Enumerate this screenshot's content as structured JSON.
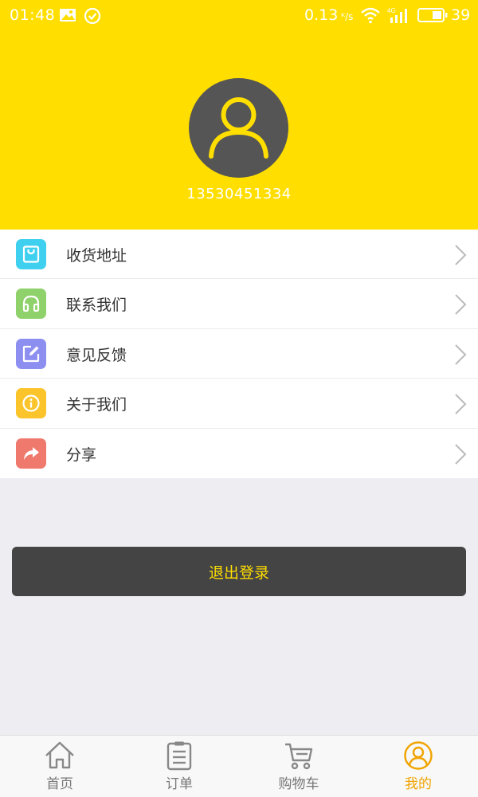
{
  "status_bar": {
    "time": "01:48",
    "speed": "0.13",
    "battery": "39",
    "icons": [
      "image-icon",
      "check-circle-icon",
      "wifi-icon",
      "signal-4g-icon",
      "battery-icon"
    ]
  },
  "profile": {
    "phone": "13530451334"
  },
  "menu": {
    "items": [
      {
        "label": "收货地址",
        "icon": "shopping-bag-icon",
        "color": "#3FD0F0"
      },
      {
        "label": "联系我们",
        "icon": "headphones-icon",
        "color": "#8FD16A"
      },
      {
        "label": "意见反馈",
        "icon": "edit-icon",
        "color": "#8C8FF0"
      },
      {
        "label": "关于我们",
        "icon": "info-icon",
        "color": "#FBC42A"
      },
      {
        "label": "分享",
        "icon": "share-icon",
        "color": "#F0796E"
      }
    ]
  },
  "logout": {
    "label": "退出登录"
  },
  "tabbar": {
    "tabs": [
      {
        "label": "首页",
        "icon": "home-icon",
        "active": false
      },
      {
        "label": "订单",
        "icon": "clipboard-icon",
        "active": false
      },
      {
        "label": "购物车",
        "icon": "cart-icon",
        "active": false
      },
      {
        "label": "我的",
        "icon": "user-circle-icon",
        "active": true
      }
    ]
  },
  "colors": {
    "header": "#FFDE00",
    "accent": "#F0A400",
    "button_bg": "#444444"
  }
}
